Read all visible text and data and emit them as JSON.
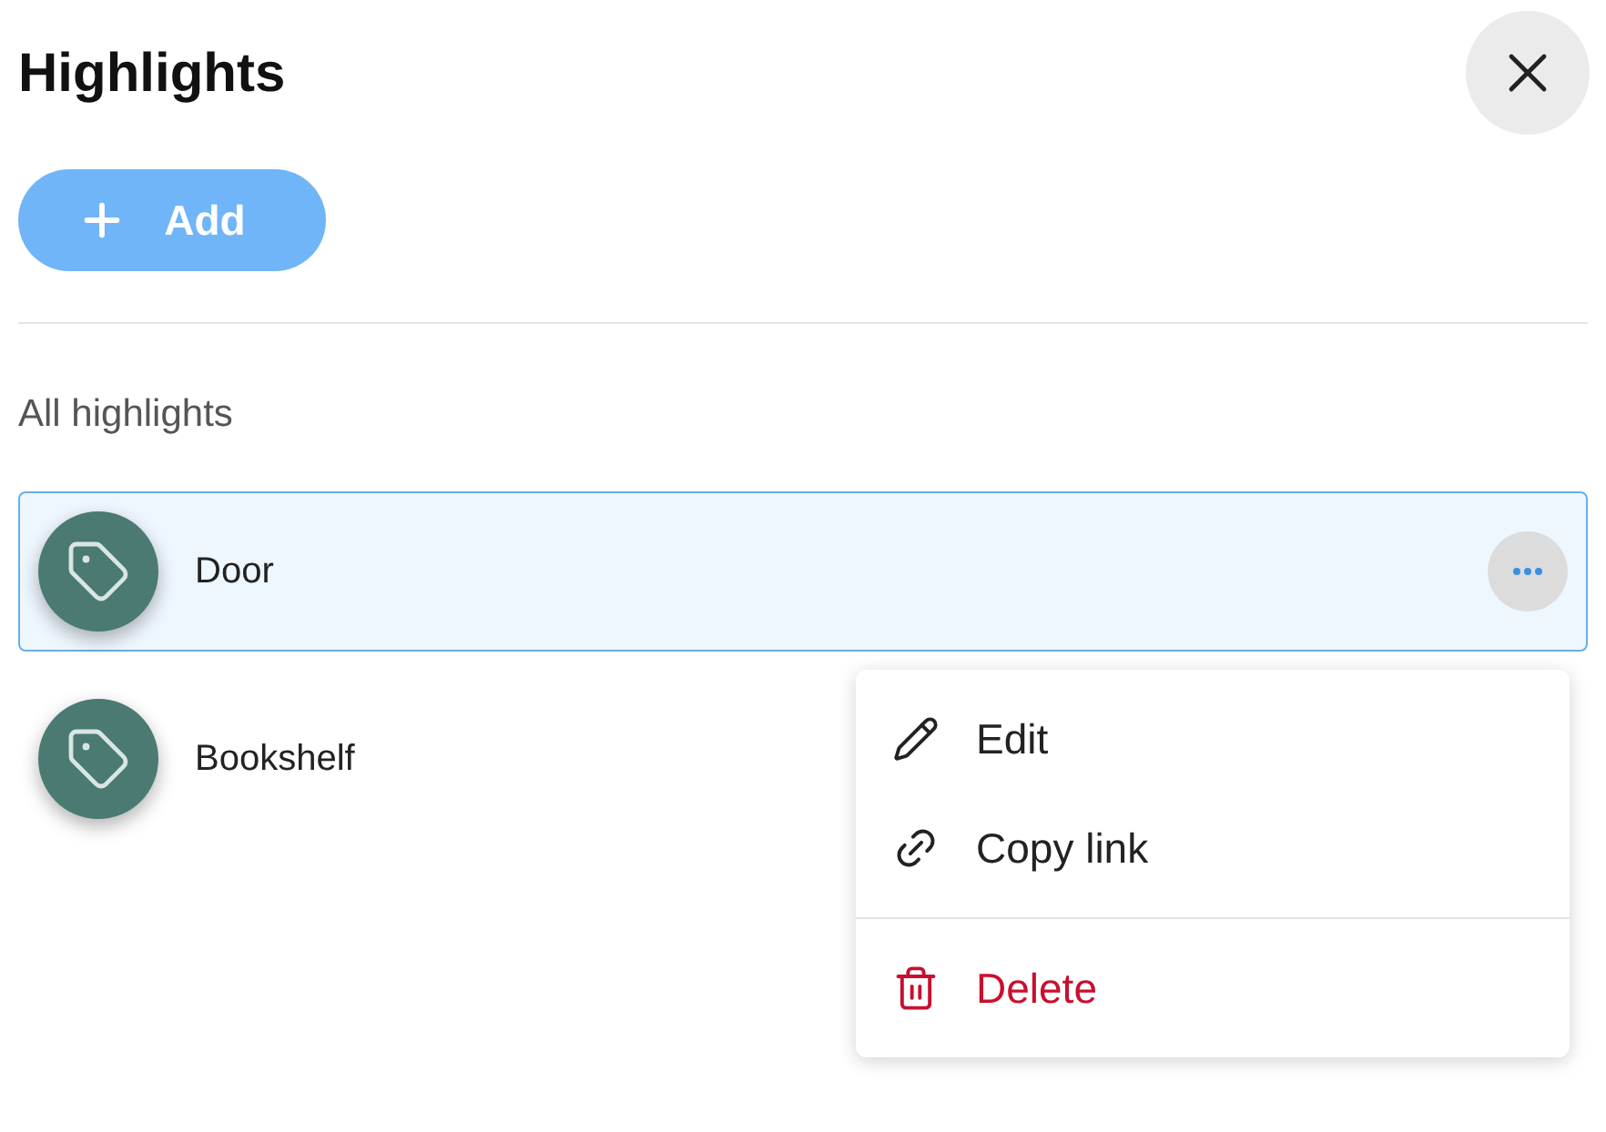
{
  "title": "Highlights",
  "add_button": {
    "label": "Add"
  },
  "section_label": "All highlights",
  "highlights": [
    {
      "name": "Door",
      "selected": true
    },
    {
      "name": "Bookshelf",
      "selected": false
    }
  ],
  "context_menu": {
    "items": [
      {
        "label": "Edit",
        "kind": "edit"
      },
      {
        "label": "Copy link",
        "kind": "link"
      },
      {
        "label": "Delete",
        "kind": "delete"
      }
    ]
  }
}
